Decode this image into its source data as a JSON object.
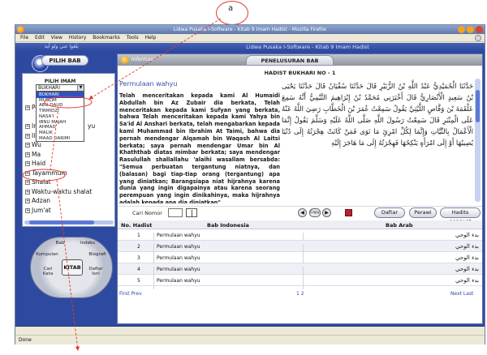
{
  "annotation": {
    "label": "a"
  },
  "window": {
    "title": "Lidwa Pusaka I-Software - Kitab 9 Imam Hadist - Mozilla Firefox"
  },
  "menu": [
    "File",
    "Edit",
    "View",
    "History",
    "Bookmarks",
    "Tools",
    "Help"
  ],
  "app": {
    "brand": "Lidwa Pusaka I-Software - Kitab 9 Imam Hadist",
    "arabic_tagline": "بلِّغوا عني ولو آية"
  },
  "left": {
    "pilih_bab": "PILIH BAB",
    "pilih_imam": "PILIH IMAM",
    "selected_imam": "BUKHARI",
    "imam_options": [
      "BUKHARI",
      "MUSLIM",
      "ABU DAUD",
      "TIRMIDZI",
      "NASA'I",
      "IBNU MAJAH",
      "AHMAD",
      "MALIK",
      "MAAD DARIMI"
    ],
    "tree": [
      {
        "exp": "+",
        "label": "Pe"
      },
      {
        "exp": "",
        "label": ""
      },
      {
        "exp": "+",
        "label": "Im"
      },
      {
        "exp": "+",
        "label": "Ilm"
      },
      {
        "exp": "+",
        "label": "Wu"
      },
      {
        "exp": "+",
        "label": "Ma"
      },
      {
        "exp": "+",
        "label": "Haid"
      },
      {
        "exp": "+",
        "label": "Tayammum"
      },
      {
        "exp": "+",
        "label": "Shalat"
      },
      {
        "exp": "+",
        "label": "Waktu-waktu shalat"
      },
      {
        "exp": "+",
        "label": "Adzan"
      },
      {
        "exp": "+",
        "label": "Jum'at"
      }
    ],
    "tree_partial": "yu",
    "dial": {
      "bab": "Bab",
      "indeks": "Indeks",
      "kumpulan": "Kumpulan",
      "biografi": "Biografi",
      "cari_kata": "Cari Kata",
      "daftar_isnl": "Daftar Isnl",
      "kitab": "KITAB"
    }
  },
  "right": {
    "info_label": "Informasi",
    "tab": "PENELUSURAN BAB",
    "hadis_title": "HADIST BUKHARI NO - 1",
    "permulaan": "Permulaan wahyu",
    "indo_text": "Telah menceritakan kepada kami Al Humaidi Abdullah bin Az Zubair dia berkata, Telah menceritakan kepada kami Sufyan yang berkata, bahwa Telah menceritakan kepada kami Yahya bin Sa'id Al Anshari berkata, telah mengabarkan kepada kami Muhammad bin Ibrahim At Taimi, bahwa dia pernah mendengar Alqamah bin Waqash Al Laitsi berkata; saya pernah mendengar Umar bin Al Khaththab diatas mimbar berkata; saya mendengar Rasulullah shallallahu 'alaihi wasallam bersabda: \"Semua perbuatan tergantung niatnya, dan (balasan) bagi tiap-tiap orang (tergantung) apa yang diniatkan; Barangsiapa niat hijrahnya karena dunia yang ingin digapainya atau karena seorang perempuan yang ingin dinikahinya, maka hijrahnya adalah kepada apa dia diniatkan\"",
    "arab_text": "حَدَّثَنَا الْحُمَيْدِيُّ عَبْدُ اللَّهِ بْنُ الزُّبَيْرِ قَالَ حَدَّثَنَا سُفْيَانُ قَالَ حَدَّثَنَا يَحْيَى بْنُ سَعِيدٍ الْأَنْصَارِيُّ قَالَ أَخْبَرَنِي مُحَمَّدُ بْنُ إِبْرَاهِيمَ التَّيْمِيُّ أَنَّهُ سَمِعَ عَلْقَمَةَ بْنَ وَقَّاصٍ اللَّيْثِيَّ يَقُولُ سَمِعْتُ عُمَرَ بْنَ الْخَطَّابِ رَضِيَ اللَّهُ عَنْهُ عَلَى الْمِنْبَرِ قَالَ سَمِعْتُ رَسُولَ اللَّهِ صَلَّى اللَّهُ عَلَيْهِ وَسَلَّمَ يَقُولُ إِنَّمَا الْأَعْمَالُ بِالنِّيَّاتِ وَإِنَّمَا لِكُلِّ امْرِئٍ مَا نَوَى فَمَنْ كَانَتْ هِجْرَتُهُ إِلَى دُنْيَا يُصِيبُهَا أَوْ إِلَى امْرَأَةٍ يَنْكِحُهَا فَهِجْرَتُهُ إِلَى مَا هَاجَرَ إِلَيْهِ",
    "toolbar": {
      "cari_nomor": "Cari Nomor",
      "copy": "Copy",
      "daftar": "Daftar",
      "perawi": "Perawi",
      "hadits_penguat": "Hadits penguat"
    },
    "table": {
      "headers": {
        "no": "No. Hadist",
        "indo": "Bab Indonesia",
        "arab": "Bab Arab"
      },
      "rows": [
        {
          "no": "1",
          "indo": "Permulaan wahyu",
          "arab": "بدء الوحي"
        },
        {
          "no": "2",
          "indo": "Permulaan wahyu",
          "arab": "بدء الوحي"
        },
        {
          "no": "3",
          "indo": "Permulaan wahyu",
          "arab": "بدء الوحي"
        },
        {
          "no": "4",
          "indo": "Permulaan wahyu",
          "arab": "بدء الوحي"
        },
        {
          "no": "5",
          "indo": "Permulaan wahyu",
          "arab": "بدء الوحي"
        }
      ]
    },
    "pager": {
      "first_prev": "First Prev",
      "pages": "1 2",
      "next_last": "Next Last"
    }
  },
  "status": "Done"
}
